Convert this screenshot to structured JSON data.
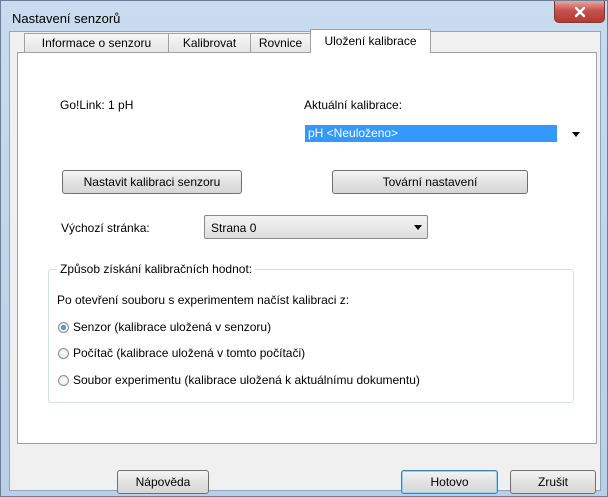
{
  "window": {
    "title": "Nastavení senzorů"
  },
  "tabs": [
    {
      "label": "Informace o senzoru",
      "active": false
    },
    {
      "label": "Kalibrovat",
      "active": false
    },
    {
      "label": "Rovnice",
      "active": false
    },
    {
      "label": "Uložení kalibrace",
      "active": true
    }
  ],
  "sensor": {
    "name": "Go!Link: 1 pH"
  },
  "current_calibration": {
    "label": "Aktuální kalibrace:",
    "value": "pH <Neuloženo>",
    "selection_color": "#3399ff"
  },
  "buttons": {
    "set_sensor_calibration": "Nastavit kalibraci senzoru",
    "factory_settings": "Tovární nastavení",
    "help": "Nápověda",
    "done": "Hotovo",
    "cancel": "Zrušit"
  },
  "default_page": {
    "label": "Výchozí stránka:",
    "value": "Strana 0"
  },
  "calibration_source": {
    "group_label": "Způsob získání kalibračních hodnot:",
    "prompt": "Po otevření souboru s experimentem načíst kalibraci z:",
    "options": [
      {
        "label": "Senzor (kalibrace uložená v senzoru)",
        "checked": true
      },
      {
        "label": "Počítač (kalibrace uložená v tomto počítači)",
        "checked": false
      },
      {
        "label": "Soubor experimentu (kalibrace uložená k aktuálnímu dokumentu)",
        "checked": false
      }
    ]
  },
  "icons": {
    "close": "close-icon",
    "dropdown": "chevron-down-icon"
  }
}
